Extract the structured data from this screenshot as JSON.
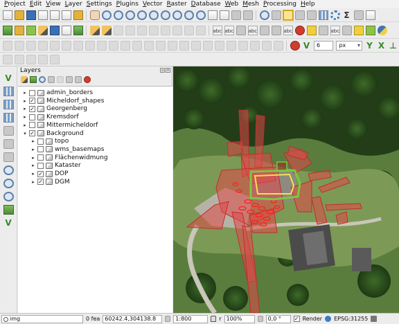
{
  "menu": [
    "Project",
    "Edit",
    "View",
    "Layer",
    "Settings",
    "Plugins",
    "Vector",
    "Raster",
    "Database",
    "Web",
    "Mesh",
    "Processing",
    "Help"
  ],
  "snapping": {
    "size": "6",
    "unit": "px"
  },
  "layers_panel": {
    "title": "Layers"
  },
  "layers": [
    {
      "name": "admin_borders",
      "checked": false,
      "depth": 0,
      "expanded": false
    },
    {
      "name": "Micheldorf_shapes",
      "checked": true,
      "depth": 0,
      "expanded": false
    },
    {
      "name": "Georgenberg",
      "checked": true,
      "depth": 0,
      "expanded": false
    },
    {
      "name": "Kremsdorf",
      "checked": false,
      "depth": 0,
      "expanded": false
    },
    {
      "name": "Mittermicheldorf",
      "checked": false,
      "depth": 0,
      "expanded": false
    },
    {
      "name": "Background",
      "checked": true,
      "depth": 0,
      "expanded": true
    },
    {
      "name": "topo",
      "checked": false,
      "depth": 1,
      "expanded": false
    },
    {
      "name": "wms_basemaps",
      "checked": false,
      "depth": 1,
      "expanded": false
    },
    {
      "name": "Flächenwidmung",
      "checked": false,
      "depth": 1,
      "expanded": false
    },
    {
      "name": "Kataster",
      "checked": false,
      "depth": 1,
      "expanded": false
    },
    {
      "name": "DOP",
      "checked": true,
      "depth": 1,
      "expanded": false
    },
    {
      "name": "DGM",
      "checked": true,
      "depth": 1,
      "expanded": false
    }
  ],
  "statusbar": {
    "search_value": "img",
    "features": "0 fea",
    "coordinate": "60242.4,304138.8",
    "scale": "1:800",
    "magnifier_label": "r",
    "magnifier": "100%",
    "rotation": "0,0 °",
    "render_label": "Render",
    "crs": "EPSG:31255"
  },
  "colors": {
    "accent_selection": "#f5d76e",
    "map_highlight": "#e04848",
    "map_green_outline": "#7ac943"
  }
}
